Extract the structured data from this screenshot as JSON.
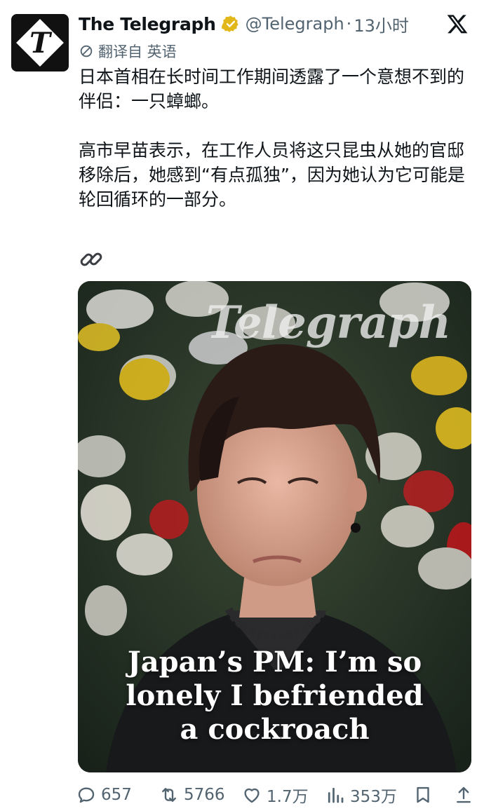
{
  "author": {
    "name": "The Telegraph",
    "handle": "@Telegraph",
    "separator": "·",
    "time": "13小时",
    "avatar_letter": "T",
    "verified_color": "#e2b719"
  },
  "translation": {
    "label": "翻译自 英语"
  },
  "tweet": {
    "paragraph1": "日本首相在长时间工作期间透露了一个意想不到的伴侣：一只蟑螂。",
    "paragraph2": "高市早苗表示，在工作人员将这只昆虫从她的官邸移除后，她感到“有点孤独”，因为她认为它可能是轮回循环的一部分。"
  },
  "media": {
    "watermark": "Telegraph",
    "headline_line1": "Japan’s PM: I’m so",
    "headline_line2": "lonely I befriended",
    "headline_line3": "a cockroach"
  },
  "actions": {
    "replies": "657",
    "retweets": "5766",
    "likes": "1.7万",
    "views": "353万"
  },
  "icons": {
    "reply": "reply-icon",
    "retweet": "retweet-icon",
    "like": "heart-icon",
    "views": "views-icon",
    "bookmark": "bookmark-icon",
    "share": "share-icon",
    "link": "link-icon",
    "x_logo": "x-logo-icon",
    "translate": "translate-icon"
  },
  "colors": {
    "text_primary": "#0f1419",
    "text_secondary": "#536471"
  }
}
